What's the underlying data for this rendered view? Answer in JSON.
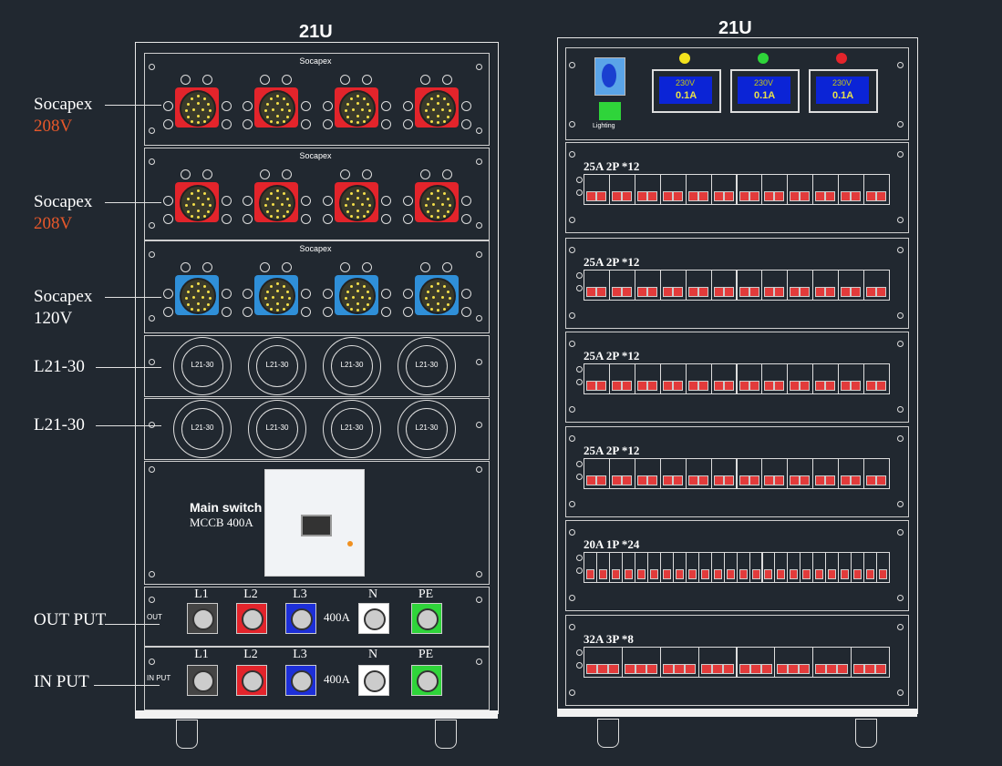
{
  "left_rack": {
    "title": "21U",
    "labels": {
      "socapex": "Socapex",
      "v208": "208V",
      "v120": "120V",
      "l2130": "L21-30",
      "output": "OUT PUT",
      "input": "IN PUT",
      "main_switch": "Main switch",
      "mccb": "MCCB 400A"
    },
    "panel_titles": [
      "Socapex",
      "Socapex",
      "Socapex"
    ],
    "twistlock_label": "L21-30",
    "out_tag": "OUT",
    "in_tag": "IN PUT",
    "bus_headers": [
      "L1",
      "L2",
      "L3",
      "N",
      "PE"
    ],
    "bus_rating": "400A",
    "colors": {
      "red": "#e3242b",
      "blue": "#2f8fd8",
      "green": "#2fd43a",
      "orange": "#e8582a"
    }
  },
  "right_rack": {
    "title": "21U",
    "lighting_label": "Lighting",
    "meters": [
      {
        "voltage": "230V",
        "current": "0.1A",
        "led": "#f3e21d"
      },
      {
        "voltage": "230V",
        "current": "0.1A",
        "led": "#2fd43a"
      },
      {
        "voltage": "230V",
        "current": "0.1A",
        "led": "#e3242b"
      }
    ],
    "breaker_rows": [
      {
        "label": "25A  2P *12",
        "count": 12,
        "poles": 2
      },
      {
        "label": "25A  2P *12",
        "count": 12,
        "poles": 2
      },
      {
        "label": "25A  2P *12",
        "count": 12,
        "poles": 2
      },
      {
        "label": "25A  2P *12",
        "count": 12,
        "poles": 2
      },
      {
        "label": "20A  1P *24",
        "count": 24,
        "poles": 1
      },
      {
        "label": "32A  3P *8",
        "count": 8,
        "poles": 3
      }
    ]
  }
}
